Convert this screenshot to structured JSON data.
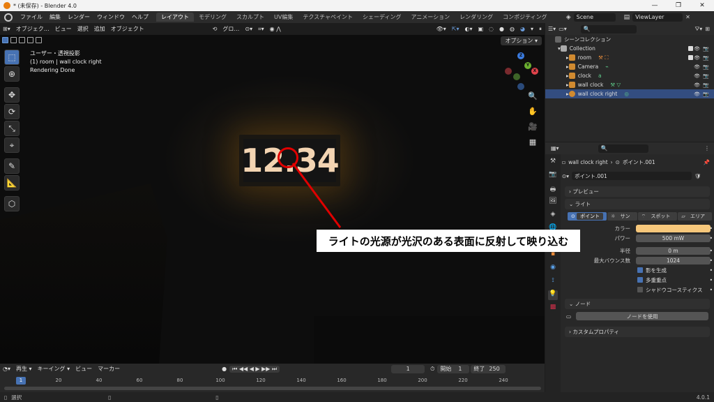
{
  "window": {
    "title": "* (未保存) - Blender 4.0",
    "controls": [
      "—",
      "❐",
      "✕"
    ]
  },
  "menu": [
    "ファイル",
    "編集",
    "レンダー",
    "ウィンドウ",
    "ヘルプ"
  ],
  "workspaces": [
    {
      "label": "レイアウト",
      "active": true
    },
    {
      "label": "モデリング"
    },
    {
      "label": "スカルプト"
    },
    {
      "label": "UV編集"
    },
    {
      "label": "テクスチャペイント"
    },
    {
      "label": "シェーディング"
    },
    {
      "label": "アニメーション"
    },
    {
      "label": "レンダリング"
    },
    {
      "label": "コンポジティング"
    }
  ],
  "scene": {
    "name": "Scene",
    "view_layer": "ViewLayer"
  },
  "viewport": {
    "header": [
      "オブジェク…",
      "ビュー",
      "選択",
      "追加",
      "オブジェクト"
    ],
    "transform": "グロ…",
    "options": "オプション",
    "info": [
      "ユーザー・透視投影",
      "(1) room | wall clock right",
      "Rendering Done"
    ],
    "gizmo": {
      "x": "X",
      "y": "Y",
      "z": "Z"
    },
    "clock_text": "12.34"
  },
  "annotation": {
    "callout": "ライトの光源が光沢のある表面に反射して映り込む",
    "accent": "#e00000"
  },
  "outliner": {
    "root": "シーンコレクション",
    "items": [
      {
        "label": "Collection",
        "level": 1,
        "icon": "collection-icon"
      },
      {
        "label": "room",
        "level": 2,
        "icon": "mesh-icon"
      },
      {
        "label": "Camera",
        "level": 2,
        "icon": "camera-icon"
      },
      {
        "label": "clock",
        "level": 2,
        "icon": "text-icon"
      },
      {
        "label": "wall clock",
        "level": 2,
        "icon": "mesh-icon"
      },
      {
        "label": "wall clock right",
        "level": 2,
        "icon": "light-icon"
      }
    ]
  },
  "properties": {
    "breadcrumb_object": "wall clock right",
    "breadcrumb_data": "ポイント.001",
    "datablock": "ポイント.001",
    "preview_label": "プレビュー",
    "light_label": "ライト",
    "light_types": [
      {
        "label": "ポイント",
        "active": true
      },
      {
        "label": "サン"
      },
      {
        "label": "スポット"
      },
      {
        "label": "エリア"
      }
    ],
    "fields": {
      "color_label": "カラー",
      "color_value": "#f6c77b",
      "power_label": "パワー",
      "power_value": "500 mW",
      "radius_label": "半径",
      "radius_value": "0 m",
      "bounce_label": "最大バウンス数",
      "bounce_value": "1024"
    },
    "checks": [
      {
        "label": "影を生成",
        "on": true
      },
      {
        "label": "多重重点",
        "on": true
      },
      {
        "label": "シャドウコースティクス",
        "on": false
      }
    ],
    "nodes_label": "ノード",
    "use_nodes": "ノードを使用",
    "custom_props": "カスタムプロパティ"
  },
  "timeline": {
    "menus": [
      "再生",
      "キーイング",
      "ビュー",
      "マーカー"
    ],
    "current": "1",
    "start_label": "開始",
    "start": "1",
    "end_label": "終了",
    "end": "250",
    "ruler": [
      "20",
      "40",
      "60",
      "80",
      "100",
      "120",
      "140",
      "160",
      "180",
      "200",
      "220",
      "240"
    ],
    "cursor": "1"
  },
  "status": {
    "left": "選択",
    "version": "4.0.1"
  }
}
